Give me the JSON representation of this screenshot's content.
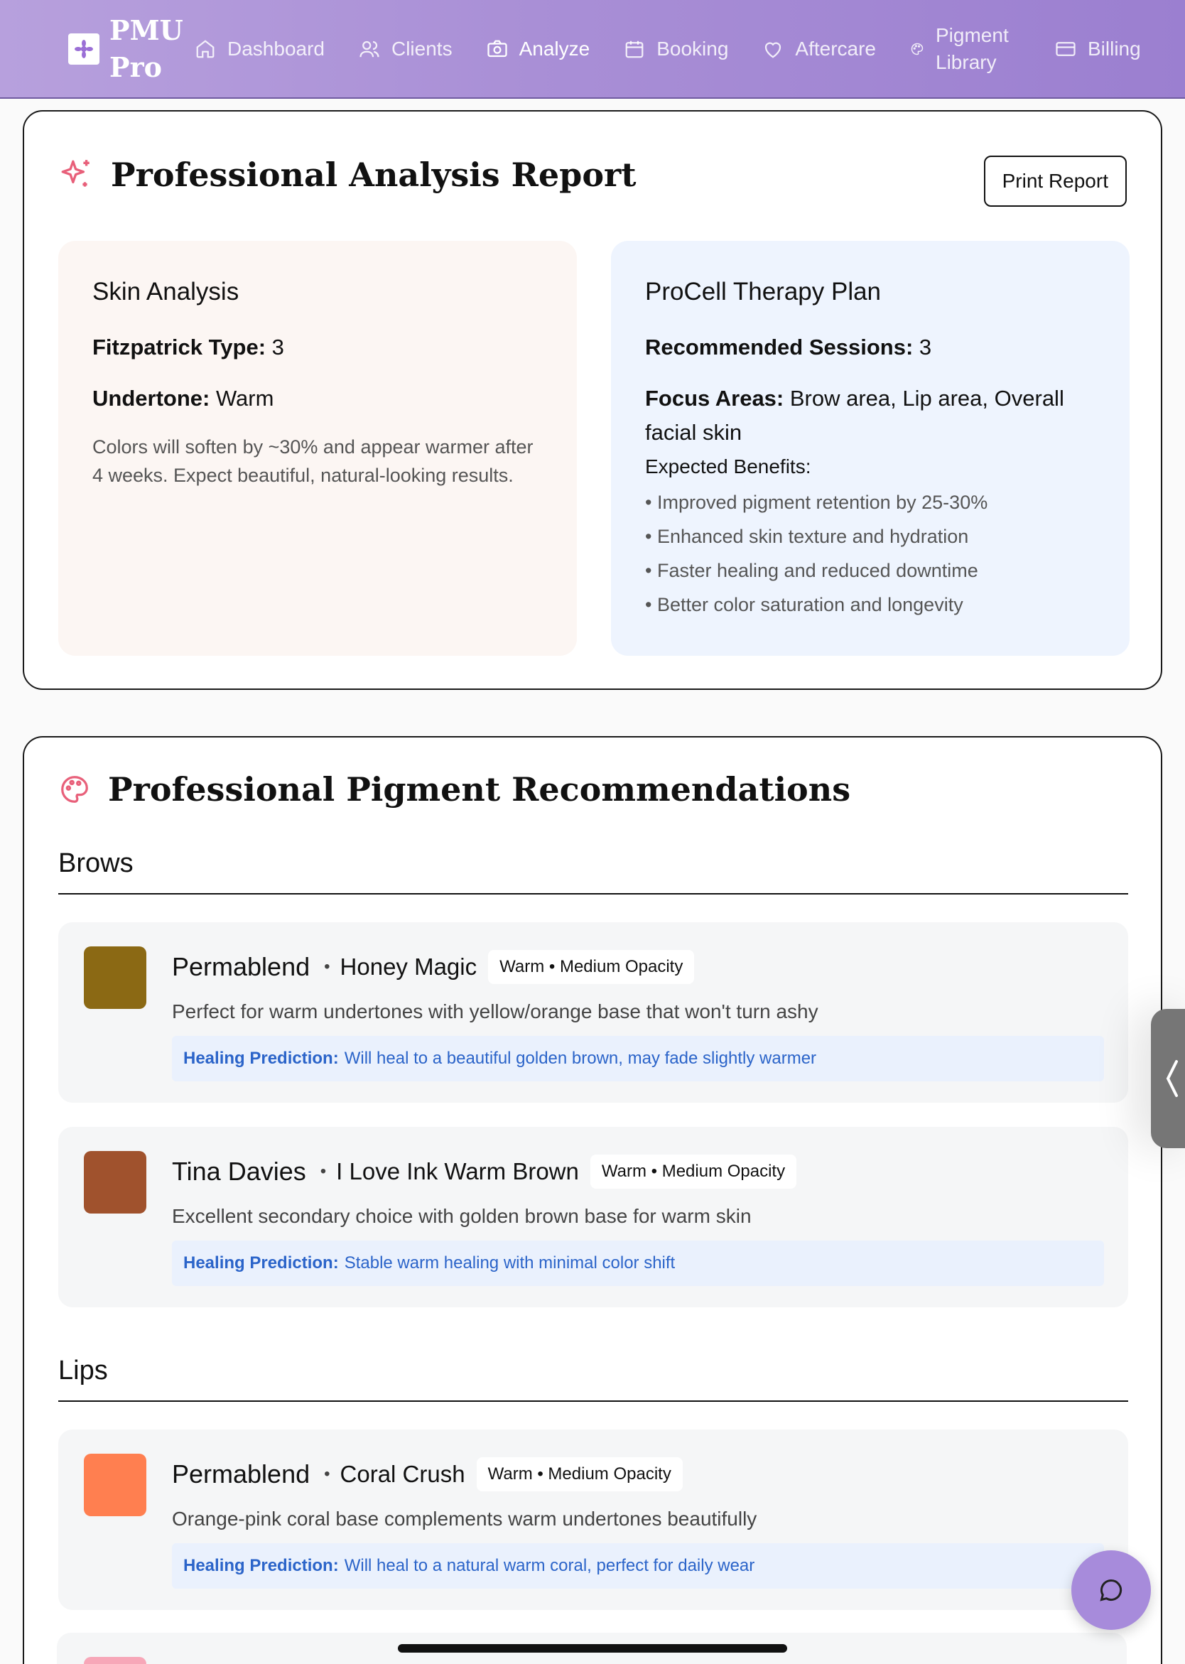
{
  "app": {
    "name": "PMU Pro"
  },
  "nav": {
    "items": [
      {
        "label": "Dashboard",
        "icon": "home-icon"
      },
      {
        "label": "Clients",
        "icon": "users-icon"
      },
      {
        "label": "Analyze",
        "icon": "camera-icon",
        "active": true
      },
      {
        "label": "Booking",
        "icon": "calendar-icon"
      },
      {
        "label": "Aftercare",
        "icon": "heart-icon"
      },
      {
        "label": "Pigment Library",
        "icon": "palette-icon"
      },
      {
        "label": "Billing",
        "icon": "card-icon"
      }
    ]
  },
  "report": {
    "title": "Professional Analysis Report",
    "print_label": "Print Report",
    "skin": {
      "heading": "Skin Analysis",
      "fitz_label": "Fitzpatrick Type:",
      "fitz_value": "3",
      "undertone_label": "Undertone:",
      "undertone_value": "Warm",
      "description": "Colors will soften by ~30% and appear warmer after 4 weeks. Expect beautiful, natural-looking results."
    },
    "procell": {
      "heading": "ProCell Therapy Plan",
      "sessions_label": "Recommended Sessions:",
      "sessions_value": "3",
      "focus_label": "Focus Areas:",
      "focus_value": "Brow area, Lip area, Overall facial skin",
      "benefits_title": "Expected Benefits:",
      "benefits": [
        "• Improved pigment retention by 25-30%",
        "• Enhanced skin texture and hydration",
        "• Faster healing and reduced downtime",
        "• Better color saturation and longevity"
      ]
    }
  },
  "pigments": {
    "title": "Professional Pigment Recommendations",
    "sections": [
      {
        "heading": "Brows",
        "items": [
          {
            "brand": "Permablend",
            "shade": "Honey Magic",
            "tag": "Warm • Medium Opacity",
            "color": "#8b6914",
            "description": "Perfect for warm undertones with yellow/orange base that won't turn ashy",
            "heal_label": "Healing Prediction:",
            "heal_text": "Will heal to a beautiful golden brown, may fade slightly warmer"
          },
          {
            "brand": "Tina Davies",
            "shade": "I Love Ink Warm Brown",
            "tag": "Warm • Medium Opacity",
            "color": "#a0522d",
            "description": "Excellent secondary choice with golden brown base for warm skin",
            "heal_label": "Healing Prediction:",
            "heal_text": "Stable warm healing with minimal color shift"
          }
        ]
      },
      {
        "heading": "Lips",
        "items": [
          {
            "brand": "Permablend",
            "shade": "Coral Crush",
            "tag": "Warm • Medium Opacity",
            "color": "#ff7f50",
            "description": "Orange-pink coral base complements warm undertones beautifully",
            "heal_label": "Healing Prediction:",
            "heal_text": "Will heal to a natural warm coral, perfect for daily wear"
          }
        ]
      }
    ]
  },
  "colors": {
    "accent": "#e8607a",
    "nav_gradient_start": "#b7a0dd",
    "nav_gradient_end": "#9b7fd0",
    "heal_text": "#2b64c9"
  }
}
